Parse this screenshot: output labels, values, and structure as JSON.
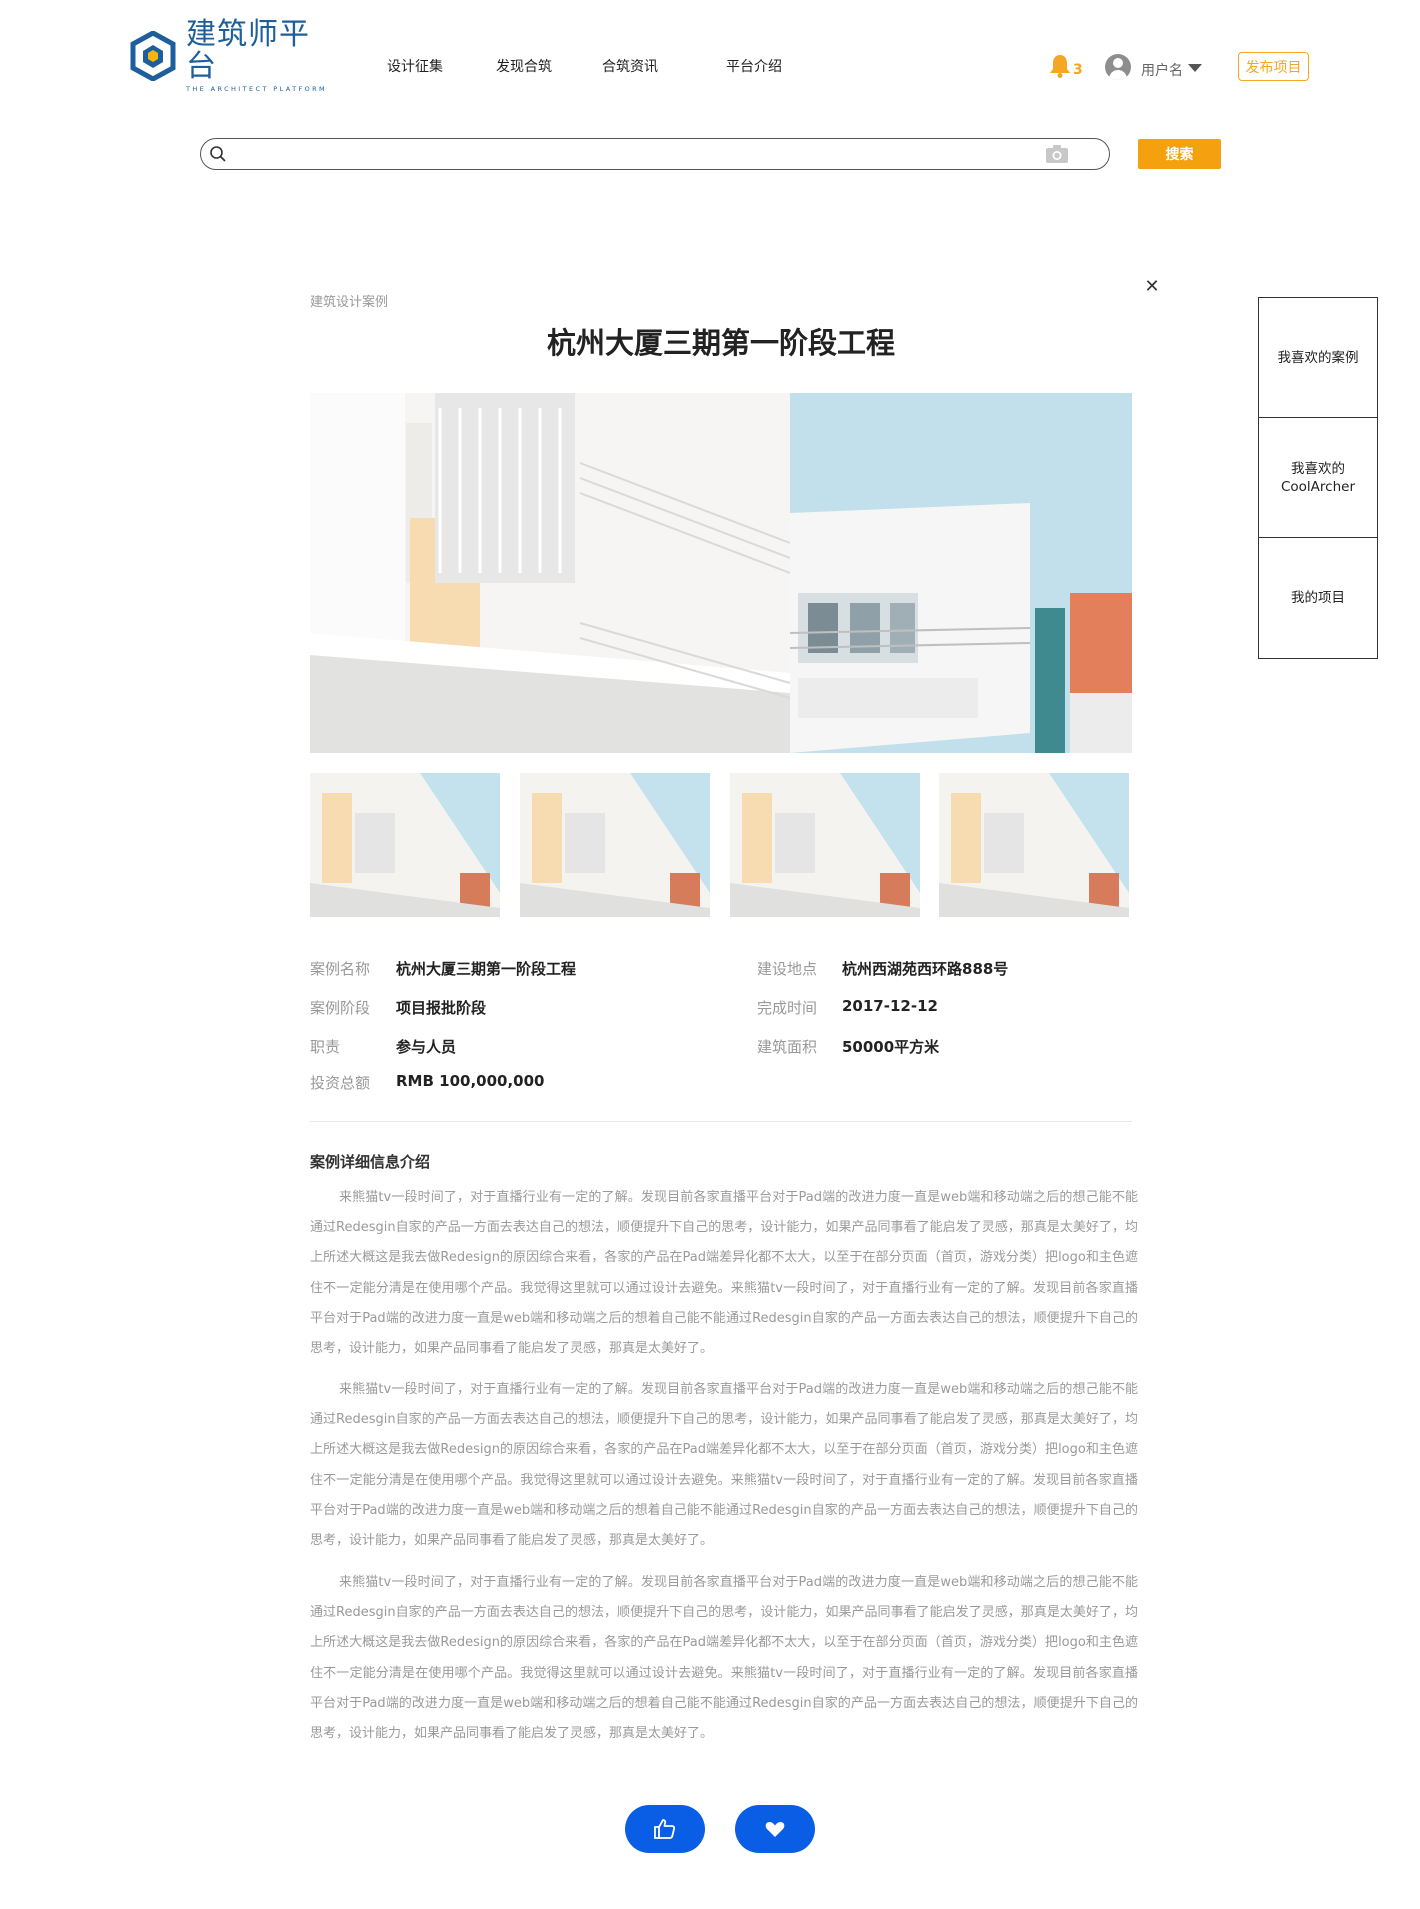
{
  "header": {
    "logo_text": "建筑师平台",
    "logo_subtitle": "THE ARCHITECT PLATFORM",
    "nav": [
      "设计征集",
      "发现合筑",
      "合筑资讯",
      "平台介绍"
    ],
    "notification_count": "3",
    "username": "用户名",
    "publish_label": "发布项目",
    "brand_color": "#1d5f9c",
    "accent_color": "#f5a623"
  },
  "search": {
    "placeholder": "",
    "button_label": "搜索"
  },
  "side_panel": {
    "items": [
      "我喜欢的案例",
      "我喜欢的 CoolArcher",
      "我的项目"
    ]
  },
  "article": {
    "category": "建筑设计案例",
    "title": "杭州大厦三期第一阶段工程",
    "close_icon": "close-icon",
    "info": {
      "name_label": "案例名称",
      "name_value": "杭州大厦三期第一阶段工程",
      "stage_label": "案例阶段",
      "stage_value": "项目报批阶段",
      "role_label": "职责",
      "role_value": "参与人员",
      "investment_label": "投资总额",
      "investment_value": "RMB 100,000,000",
      "location_label": "建设地点",
      "location_value": "杭州西湖苑西环路888号",
      "completion_label": "完成时间",
      "completion_value": "2017-12-12",
      "area_label": "建筑面积",
      "area_value": "50000平方米"
    },
    "description_heading": "案例详细信息介绍",
    "paragraphs": [
      "来熊猫tv一段时间了，对于直播行业有一定的了解。发现目前各家直播平台对于Pad端的改进力度一直是web端和移动端之后的想己能不能通过Redesgin自家的产品一方面去表达自己的想法，顺便提升下自己的思考，设计能力，如果产品同事看了能启发了灵感，那真是太美好了，均上所述大概这是我去做Redesign的原因综合来看，各家的产品在Pad端差异化都不太大，以至于在部分页面（首页，游戏分类）把logo和主色遮住不一定能分清是在使用哪个产品。我觉得这里就可以通过设计去避免。来熊猫tv一段时间了，对于直播行业有一定的了解。发现目前各家直播平台对于Pad端的改进力度一直是web端和移动端之后的想着自己能不能通过Redesgin自家的产品一方面去表达自己的想法，顺便提升下自己的思考，设计能力，如果产品同事看了能启发了灵感，那真是太美好了。",
      "来熊猫tv一段时间了，对于直播行业有一定的了解。发现目前各家直播平台对于Pad端的改进力度一直是web端和移动端之后的想己能不能通过Redesgin自家的产品一方面去表达自己的想法，顺便提升下自己的思考，设计能力，如果产品同事看了能启发了灵感，那真是太美好了，均上所述大概这是我去做Redesign的原因综合来看，各家的产品在Pad端差异化都不太大，以至于在部分页面（首页，游戏分类）把logo和主色遮住不一定能分清是在使用哪个产品。我觉得这里就可以通过设计去避免。来熊猫tv一段时间了，对于直播行业有一定的了解。发现目前各家直播平台对于Pad端的改进力度一直是web端和移动端之后的想着自己能不能通过Redesgin自家的产品一方面去表达自己的想法，顺便提升下自己的思考，设计能力，如果产品同事看了能启发了灵感，那真是太美好了。",
      "来熊猫tv一段时间了，对于直播行业有一定的了解。发现目前各家直播平台对于Pad端的改进力度一直是web端和移动端之后的想己能不能通过Redesgin自家的产品一方面去表达自己的想法，顺便提升下自己的思考，设计能力，如果产品同事看了能启发了灵感，那真是太美好了，均上所述大概这是我去做Redesign的原因综合来看，各家的产品在Pad端差异化都不太大，以至于在部分页面（首页，游戏分类）把logo和主色遮住不一定能分清是在使用哪个产品。我觉得这里就可以通过设计去避免。来熊猫tv一段时间了，对于直播行业有一定的了解。发现目前各家直播平台对于Pad端的改进力度一直是web端和移动端之后的想着自己能不能通过Redesgin自家的产品一方面去表达自己的想法，顺便提升下自己的思考，设计能力，如果产品同事看了能启发了灵感，那真是太美好了。"
    ]
  },
  "actions": {
    "like_icon": "thumbs-up-icon",
    "favorite_icon": "heart-icon",
    "button_color": "#0a5ee6"
  }
}
